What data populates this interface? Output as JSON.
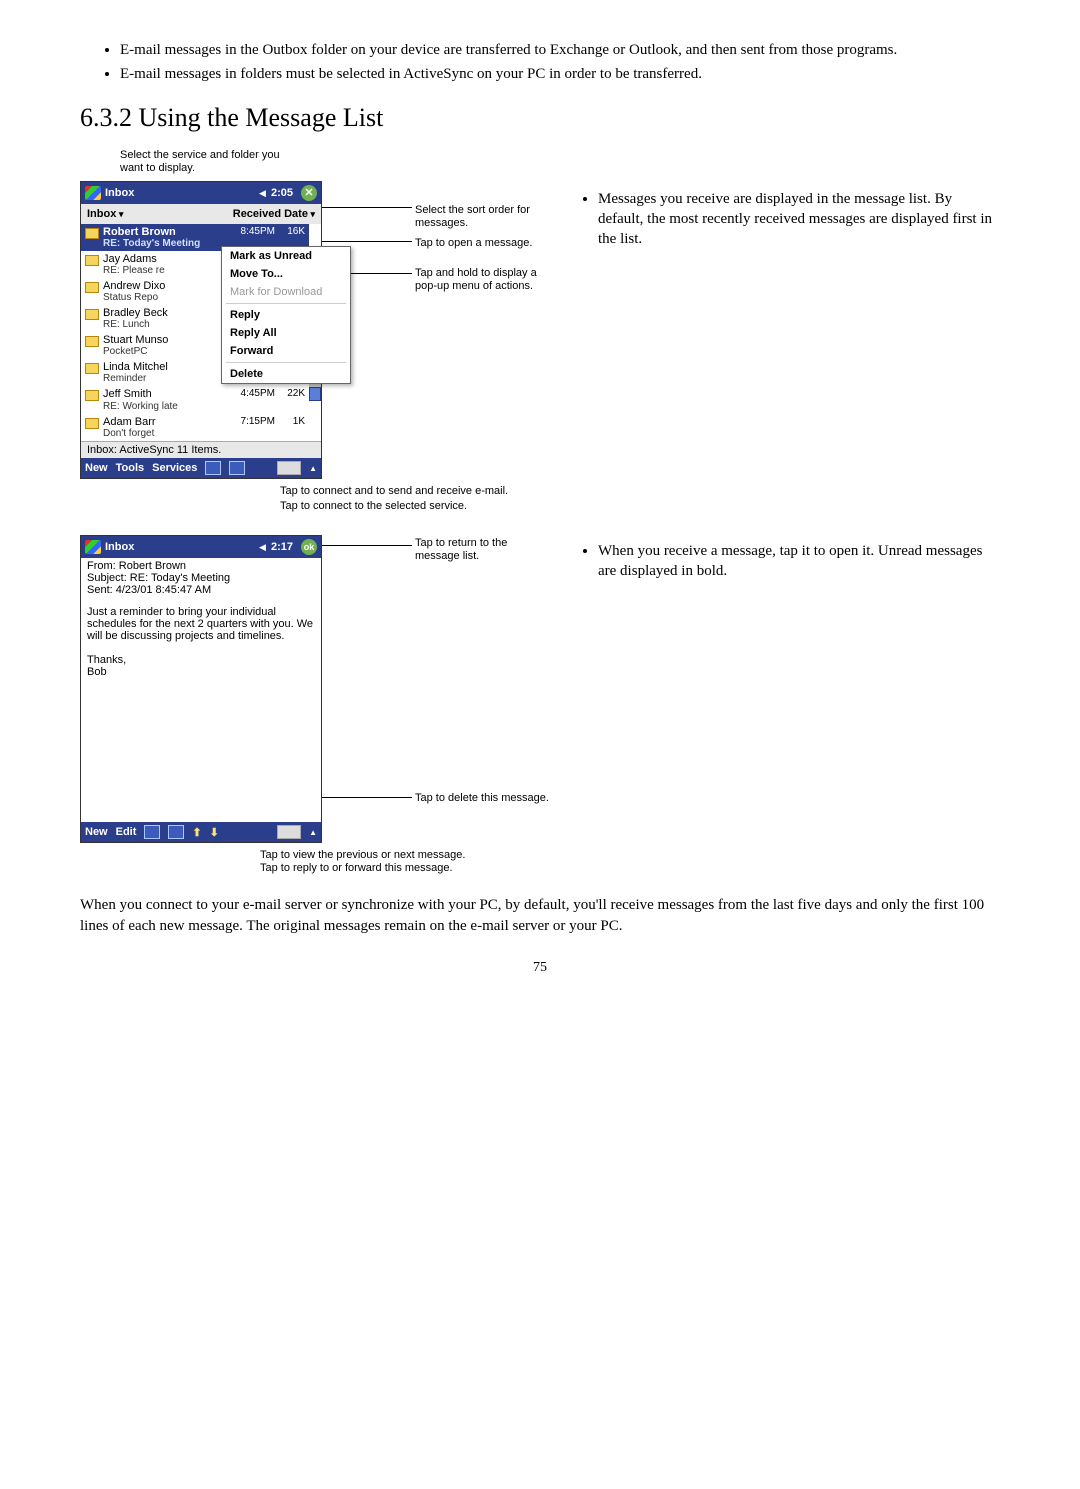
{
  "bullets_top": [
    "E-mail messages in the Outbox folder on your device are transferred to Exchange or Outlook, and then sent from those programs.",
    "E-mail messages in folders must be selected in ActiveSync on your PC in order to be transferred."
  ],
  "section_heading": "6.3.2 Using the Message List",
  "fig1": {
    "callout_top": "Select the service and folder you want to display.",
    "title": "Inbox",
    "time": "2:05",
    "close_glyph": "✕",
    "subbar_left": "Inbox",
    "subbar_right": "Received Date",
    "selected": {
      "sender": "Robert Brown",
      "time": "8:45PM",
      "size": "16K",
      "subject": "RE: Today's Meeting"
    },
    "rows": [
      {
        "sender": "Jay Adams",
        "subject": "RE: Please re"
      },
      {
        "sender": "Andrew Dixo",
        "subject": "Status Repo"
      },
      {
        "sender": "Bradley Beck",
        "subject": "RE: Lunch"
      },
      {
        "sender": "Stuart Munso",
        "subject": "PocketPC"
      },
      {
        "sender": "Linda Mitchel",
        "subject": "Reminder"
      },
      {
        "sender": "Jeff Smith",
        "subject": "RE: Working late",
        "time": "4:45PM",
        "size": "22K"
      },
      {
        "sender": "Adam Barr",
        "subject": "Don't forget",
        "time": "7:15PM",
        "size": "1K"
      }
    ],
    "popup": {
      "mark_unread": "Mark as Unread",
      "move_to": "Move To...",
      "mark_dl": "Mark for Download",
      "reply": "Reply",
      "reply_all": "Reply All",
      "forward": "Forward",
      "delete": "Delete"
    },
    "status": "Inbox: ActiveSync  11 Items.",
    "menubar": {
      "new": "New",
      "tools": "Tools",
      "services": "Services"
    },
    "callouts_right": {
      "sort": "Select the sort order for messages.",
      "open": "Tap to open a message.",
      "hold": "Tap and hold to display a pop-up menu of actions."
    },
    "callouts_below": {
      "connect_send": "Tap to connect and to send and receive e-mail.",
      "connect_service": "Tap to connect to the selected service."
    }
  },
  "right_bullets_1": [
    "Messages you receive are displayed in the message list. By default, the most recently received messages are displayed first in the list."
  ],
  "fig2": {
    "title": "Inbox",
    "time": "2:17",
    "ok": "ok",
    "from": "From: Robert Brown",
    "subject": "Subject: RE: Today's Meeting",
    "sent": "Sent: 4/23/01 8:45:47 AM",
    "body_p1": "Just a reminder to bring your individual schedules for the next 2 quarters with you. We will be discussing projects and timelines.",
    "body_p2": "Thanks,",
    "body_p3": "Bob",
    "menubar": {
      "new": "New",
      "edit": "Edit"
    },
    "callouts_right": {
      "return": "Tap to return to the message list.",
      "delete": "Tap to delete this message."
    },
    "callouts_below": {
      "prevnext": "Tap to view the previous or next message.",
      "replyfwd": "Tap to reply to or forward this message."
    }
  },
  "right_bullets_2": [
    "When you receive a message, tap it to open it. Unread messages are displayed in bold."
  ],
  "bottom_para": "When you connect to your e-mail server or synchronize with your PC, by default, you'll receive messages from the last five days and only the first 100 lines of each new message. The original messages remain on the e-mail server or your PC.",
  "page_number": "75"
}
